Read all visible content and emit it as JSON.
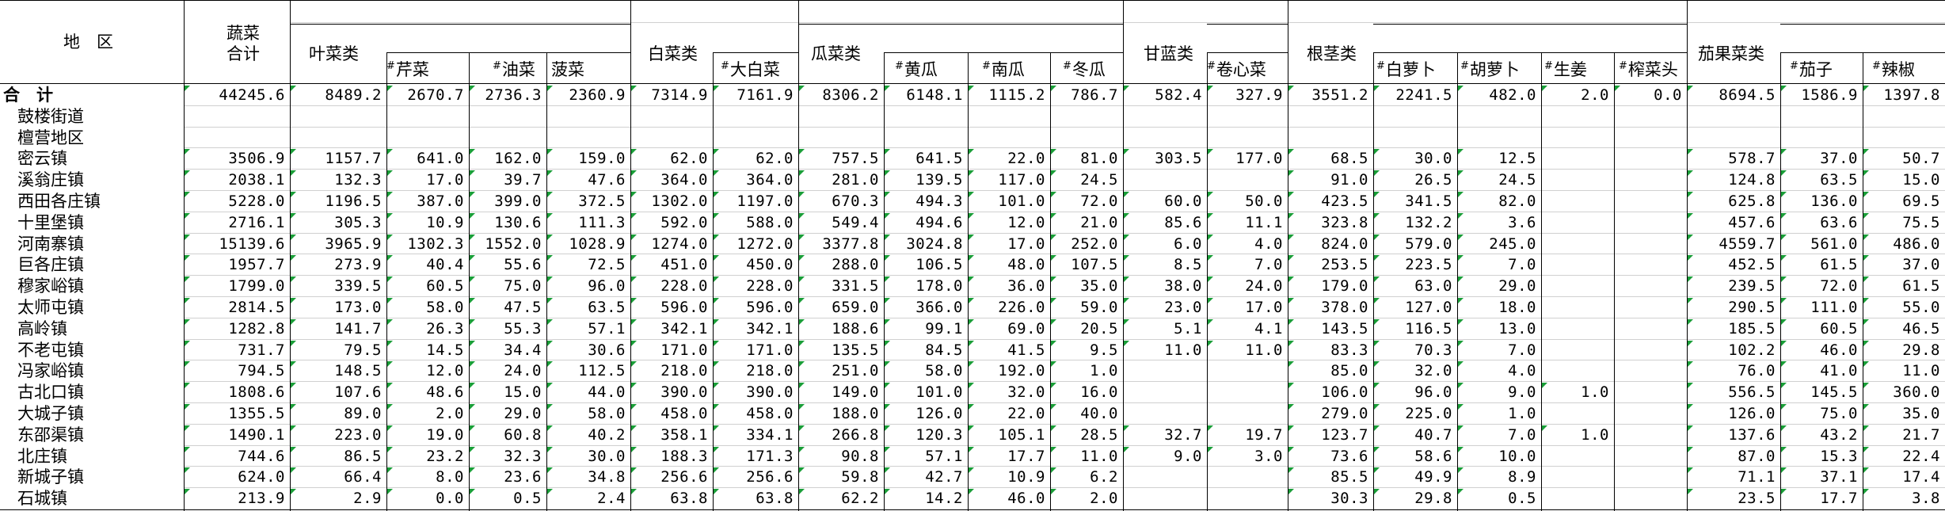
{
  "header": {
    "region": "地　区",
    "veg_total_1": "蔬菜",
    "veg_total_2": "合计",
    "groups": {
      "leafy": "叶菜类",
      "cabbage": "白菜类",
      "melon": "瓜菜类",
      "kale": "甘蓝类",
      "root": "根茎类",
      "fruit": "茄果菜类"
    },
    "subs": {
      "celery": "芹菜",
      "rape": "油菜",
      "spinach": "菠菜",
      "chinese_cabbage": "大白菜",
      "cucumber": "黄瓜",
      "pumpkin": "南瓜",
      "wax_gourd": "冬瓜",
      "cabbage_head": "卷心菜",
      "radish": "白萝卜",
      "carrot": "胡萝卜",
      "ginger": "生姜",
      "mustard": "榨菜头",
      "eggplant": "茄子",
      "pepper": "辣椒"
    },
    "mark": "#"
  },
  "rows": [
    {
      "label": "合　计",
      "values": [
        "44245.6",
        "8489.2",
        "2670.7",
        "2736.3",
        "2360.9",
        "7314.9",
        "7161.9",
        "8306.2",
        "6148.1",
        "1115.2",
        "786.7",
        "582.4",
        "327.9",
        "3551.2",
        "2241.5",
        "482.0",
        "2.0",
        "0.0",
        "8694.5",
        "1586.9",
        "1397.8"
      ]
    },
    {
      "label": "鼓楼街道",
      "values": [
        "",
        "",
        "",
        "",
        "",
        "",
        "",
        "",
        "",
        "",
        "",
        "",
        "",
        "",
        "",
        "",
        "",
        "",
        "",
        "",
        ""
      ]
    },
    {
      "label": "檀营地区",
      "values": [
        "",
        "",
        "",
        "",
        "",
        "",
        "",
        "",
        "",
        "",
        "",
        "",
        "",
        "",
        "",
        "",
        "",
        "",
        "",
        "",
        ""
      ]
    },
    {
      "label": "密云镇",
      "values": [
        "3506.9",
        "1157.7",
        "641.0",
        "162.0",
        "159.0",
        "62.0",
        "62.0",
        "757.5",
        "641.5",
        "22.0",
        "81.0",
        "303.5",
        "177.0",
        "68.5",
        "30.0",
        "12.5",
        "",
        "",
        "578.7",
        "37.0",
        "50.7"
      ]
    },
    {
      "label": "溪翁庄镇",
      "values": [
        "2038.1",
        "132.3",
        "17.0",
        "39.7",
        "47.6",
        "364.0",
        "364.0",
        "281.0",
        "139.5",
        "117.0",
        "24.5",
        "",
        "",
        "91.0",
        "26.5",
        "24.5",
        "",
        "",
        "124.8",
        "63.5",
        "15.0"
      ]
    },
    {
      "label": "西田各庄镇",
      "values": [
        "5228.0",
        "1196.5",
        "387.0",
        "399.0",
        "372.5",
        "1302.0",
        "1197.0",
        "670.3",
        "494.3",
        "101.0",
        "72.0",
        "60.0",
        "50.0",
        "423.5",
        "341.5",
        "82.0",
        "",
        "",
        "625.8",
        "136.0",
        "69.5"
      ]
    },
    {
      "label": "十里堡镇",
      "values": [
        "2716.1",
        "305.3",
        "10.9",
        "130.6",
        "111.3",
        "592.0",
        "588.0",
        "549.4",
        "494.6",
        "12.0",
        "21.0",
        "85.6",
        "11.1",
        "323.8",
        "132.2",
        "3.6",
        "",
        "",
        "457.6",
        "63.6",
        "75.5"
      ]
    },
    {
      "label": "河南寨镇",
      "values": [
        "15139.6",
        "3965.9",
        "1302.3",
        "1552.0",
        "1028.9",
        "1274.0",
        "1272.0",
        "3377.8",
        "3024.8",
        "17.0",
        "252.0",
        "6.0",
        "4.0",
        "824.0",
        "579.0",
        "245.0",
        "",
        "",
        "4559.7",
        "561.0",
        "486.0"
      ]
    },
    {
      "label": "巨各庄镇",
      "values": [
        "1957.7",
        "273.9",
        "40.4",
        "55.6",
        "72.5",
        "451.0",
        "450.0",
        "288.0",
        "106.5",
        "48.0",
        "107.5",
        "8.5",
        "7.0",
        "253.5",
        "223.5",
        "7.0",
        "",
        "",
        "452.5",
        "61.5",
        "37.0"
      ]
    },
    {
      "label": "穆家峪镇",
      "values": [
        "1799.0",
        "339.5",
        "60.5",
        "75.0",
        "96.0",
        "228.0",
        "228.0",
        "331.5",
        "178.0",
        "36.0",
        "35.0",
        "38.0",
        "24.0",
        "179.0",
        "63.0",
        "29.0",
        "",
        "",
        "239.5",
        "72.0",
        "61.5"
      ]
    },
    {
      "label": "太师屯镇",
      "values": [
        "2814.5",
        "173.0",
        "58.0",
        "47.5",
        "63.5",
        "596.0",
        "596.0",
        "659.0",
        "366.0",
        "226.0",
        "59.0",
        "23.0",
        "17.0",
        "378.0",
        "127.0",
        "18.0",
        "",
        "",
        "290.5",
        "111.0",
        "55.0"
      ]
    },
    {
      "label": "高岭镇",
      "values": [
        "1282.8",
        "141.7",
        "26.3",
        "55.3",
        "57.1",
        "342.1",
        "342.1",
        "188.6",
        "99.1",
        "69.0",
        "20.5",
        "5.1",
        "4.1",
        "143.5",
        "116.5",
        "13.0",
        "",
        "",
        "185.5",
        "60.5",
        "46.5"
      ]
    },
    {
      "label": "不老屯镇",
      "values": [
        "731.7",
        "79.5",
        "14.5",
        "34.4",
        "30.6",
        "171.0",
        "171.0",
        "135.5",
        "84.5",
        "41.5",
        "9.5",
        "11.0",
        "11.0",
        "83.3",
        "70.3",
        "7.0",
        "",
        "",
        "102.2",
        "46.0",
        "29.8"
      ]
    },
    {
      "label": "冯家峪镇",
      "values": [
        "794.5",
        "148.5",
        "12.0",
        "24.0",
        "112.5",
        "218.0",
        "218.0",
        "251.0",
        "58.0",
        "192.0",
        "1.0",
        "",
        "",
        "85.0",
        "32.0",
        "4.0",
        "",
        "",
        "76.0",
        "41.0",
        "11.0"
      ]
    },
    {
      "label": "古北口镇",
      "values": [
        "1808.6",
        "107.6",
        "48.6",
        "15.0",
        "44.0",
        "390.0",
        "390.0",
        "149.0",
        "101.0",
        "32.0",
        "16.0",
        "",
        "",
        "106.0",
        "96.0",
        "9.0",
        "1.0",
        "",
        "556.5",
        "145.5",
        "360.0"
      ]
    },
    {
      "label": "大城子镇",
      "values": [
        "1355.5",
        "89.0",
        "2.0",
        "29.0",
        "58.0",
        "458.0",
        "458.0",
        "188.0",
        "126.0",
        "22.0",
        "40.0",
        "",
        "",
        "279.0",
        "225.0",
        "1.0",
        "",
        "",
        "126.0",
        "75.0",
        "35.0"
      ]
    },
    {
      "label": "东邵渠镇",
      "values": [
        "1490.1",
        "223.0",
        "19.0",
        "60.8",
        "40.2",
        "358.1",
        "334.1",
        "266.8",
        "120.3",
        "105.1",
        "28.5",
        "32.7",
        "19.7",
        "123.7",
        "40.7",
        "7.0",
        "1.0",
        "",
        "137.6",
        "43.2",
        "21.7"
      ]
    },
    {
      "label": "北庄镇",
      "values": [
        "744.6",
        "86.5",
        "23.2",
        "32.3",
        "30.0",
        "188.3",
        "171.3",
        "90.8",
        "57.1",
        "17.7",
        "11.0",
        "9.0",
        "3.0",
        "73.6",
        "58.6",
        "10.0",
        "",
        "",
        "87.0",
        "15.3",
        "22.4"
      ]
    },
    {
      "label": "新城子镇",
      "values": [
        "624.0",
        "66.4",
        "8.0",
        "23.6",
        "34.8",
        "256.6",
        "256.6",
        "59.8",
        "42.7",
        "10.9",
        "6.2",
        "",
        "",
        "85.5",
        "49.9",
        "8.9",
        "",
        "",
        "71.1",
        "37.1",
        "17.4"
      ]
    },
    {
      "label": "石城镇",
      "values": [
        "213.9",
        "2.9",
        "0.0",
        "0.5",
        "2.4",
        "63.8",
        "63.8",
        "62.2",
        "14.2",
        "46.0",
        "2.0",
        "",
        "",
        "30.3",
        "29.8",
        "0.5",
        "",
        "",
        "23.5",
        "17.7",
        "3.8"
      ]
    }
  ],
  "accent": {
    "flag_color": "#1a9e38",
    "grid_color": "#000000"
  }
}
